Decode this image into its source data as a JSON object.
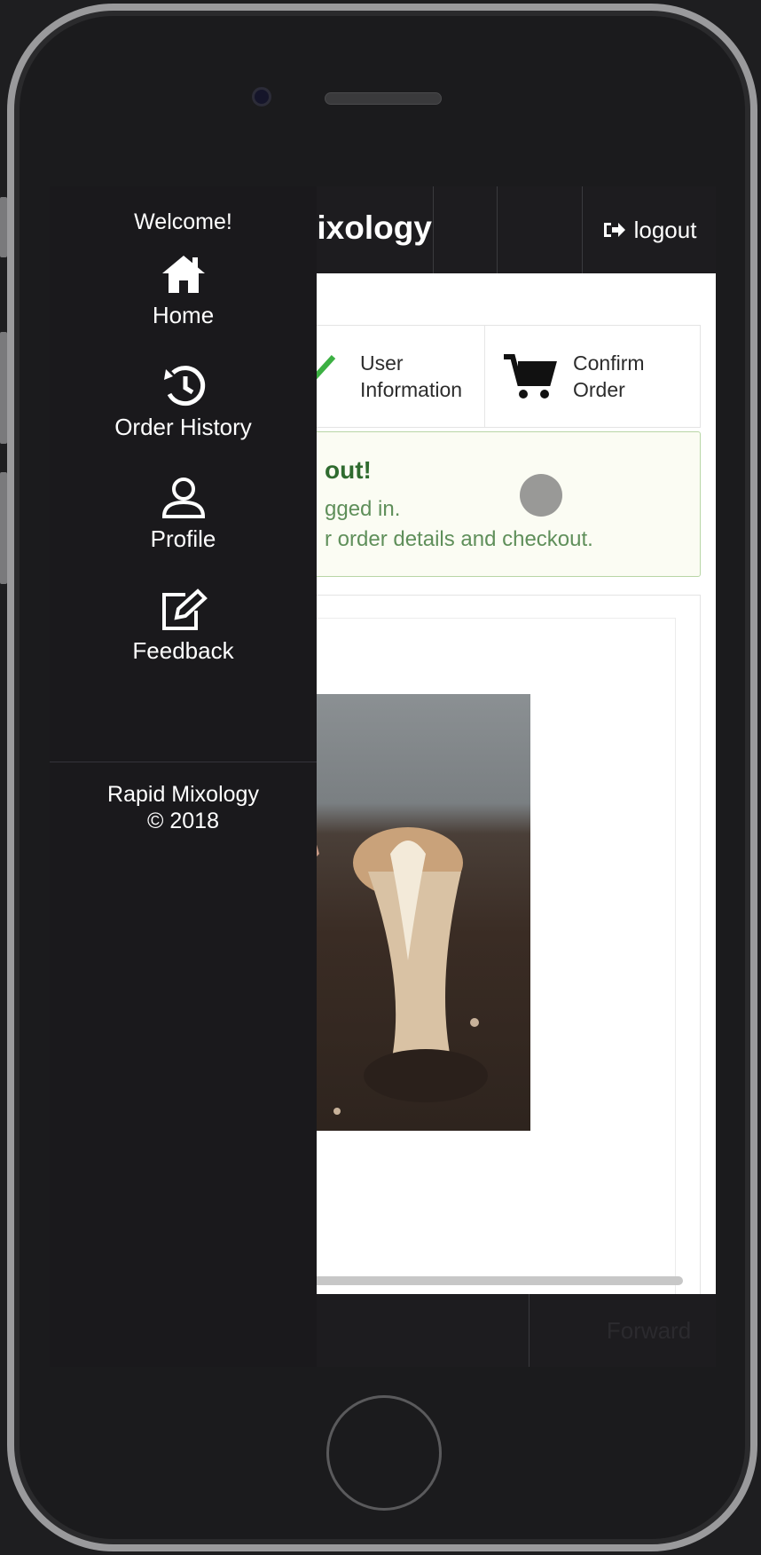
{
  "app": {
    "brand_partial": "l Mixology",
    "logout_label": "logout",
    "forward_label": "Forward"
  },
  "steps": {
    "user_info_line1": "User",
    "user_info_line2": "Information",
    "confirm_line1": "Confirm",
    "confirm_line2": "Order"
  },
  "alert": {
    "title": "out!",
    "line1": "gged in.",
    "line2": "r order details and checkout."
  },
  "drawer": {
    "welcome": "Welcome!",
    "items": [
      {
        "label": "Home",
        "icon": "home-icon"
      },
      {
        "label": "Order History",
        "icon": "history-icon"
      },
      {
        "label": "Profile",
        "icon": "user-icon"
      },
      {
        "label": "Feedback",
        "icon": "edit-icon"
      }
    ],
    "footer_line1": "Rapid Mixology",
    "footer_line2": "© 2018"
  },
  "colors": {
    "bar": "#1d1c1f",
    "drawer": "#1a191c",
    "success_green": "#2f6b2f",
    "check_green": "#3cb043"
  }
}
